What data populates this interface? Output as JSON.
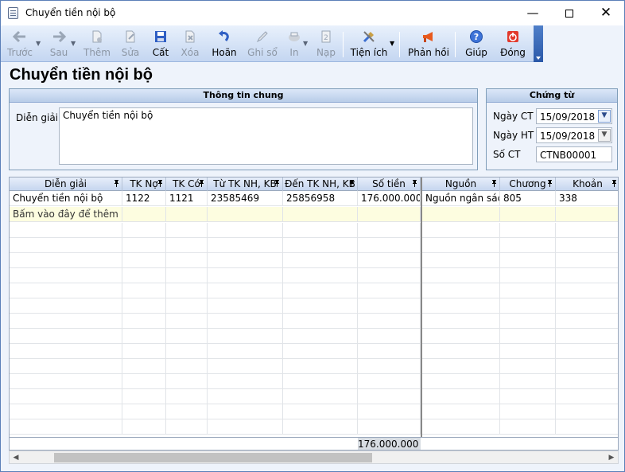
{
  "window": {
    "title": "Chuyển tiền nội bộ"
  },
  "toolbar": {
    "back": "Trước",
    "next": "Sau",
    "add": "Thêm",
    "edit": "Sửa",
    "save": "Cất",
    "delete": "Xóa",
    "undo": "Hoãn",
    "post": "Ghi sổ",
    "print": "In",
    "load": "Nạp",
    "utilities": "Tiện ích",
    "feedback": "Phản hồi",
    "help": "Giúp",
    "close": "Đóng"
  },
  "page_title": "Chuyển tiền nội bộ",
  "general_info": {
    "heading": "Thông tin chung",
    "description_label": "Diễn giải",
    "description_value": "Chuyển tiền nội bộ"
  },
  "voucher": {
    "heading": "Chứng từ",
    "voucher_date_label": "Ngày CT",
    "voucher_date_value": "15/09/2018",
    "posting_date_label": "Ngày HT",
    "posting_date_value": "15/09/2018",
    "voucher_no_label": "Số CT",
    "voucher_no_value": "CTNB00001"
  },
  "grid": {
    "columns": [
      "Diễn giải",
      "TK Nợ",
      "TK Có",
      "Từ TK NH, KB",
      "Đến TK NH, KB",
      "Số tiền",
      "Nguồn",
      "Chương",
      "Khoản"
    ],
    "rows": [
      [
        "Chuyển tiền nội bộ",
        "1122",
        "1121",
        "23585469",
        "25856958",
        "176.000.000",
        "Nguồn ngân sác...",
        "805",
        "338"
      ]
    ],
    "add_row_text": "Bấm vào đây để thêm mới",
    "total": "176.000.000"
  }
}
